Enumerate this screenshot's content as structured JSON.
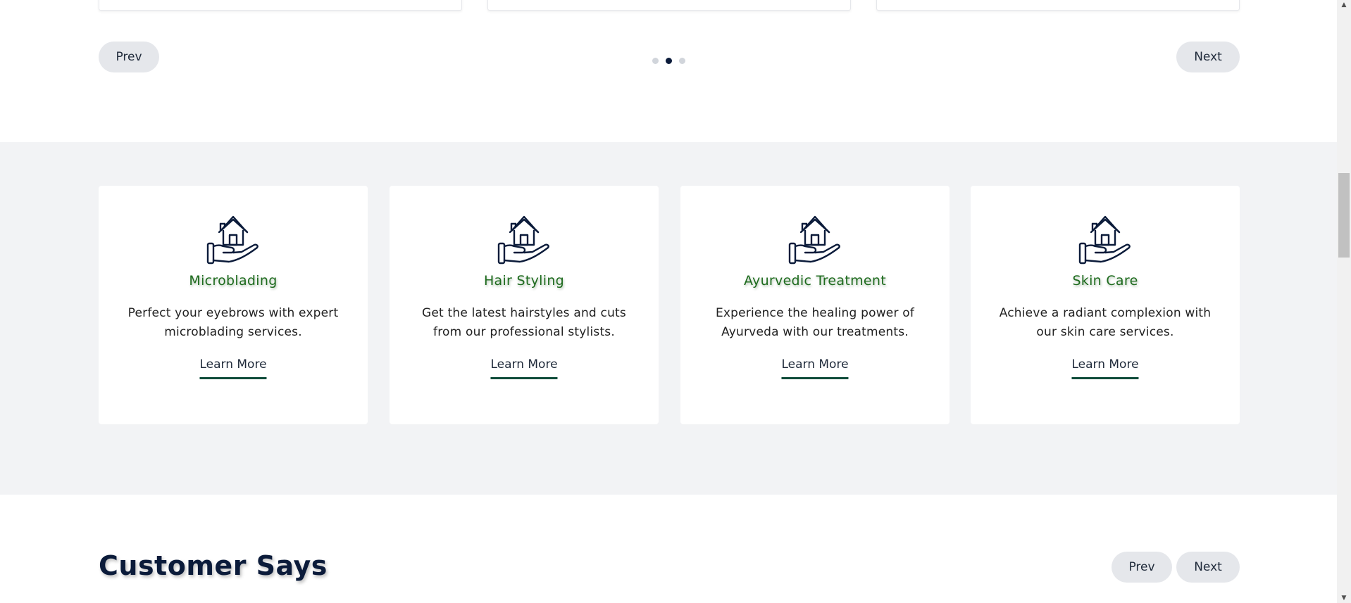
{
  "top_carousel": {
    "prev_label": "Prev",
    "next_label": "Next",
    "pages": 3,
    "active_page": 2
  },
  "services": [
    {
      "icon": "house-in-hand-icon",
      "title": "Microblading",
      "description": "Perfect your eyebrows with expert microblading services.",
      "link": "Learn More"
    },
    {
      "icon": "house-in-hand-icon",
      "title": "Hair Styling",
      "description": "Get the latest hairstyles and cuts from our professional stylists.",
      "link": "Learn More"
    },
    {
      "icon": "house-in-hand-icon",
      "title": "Ayurvedic Treatment",
      "description": "Experience the healing power of Ayurveda with our treatments.",
      "link": "Learn More"
    },
    {
      "icon": "house-in-hand-icon",
      "title": "Skin Care",
      "description": "Achieve a radiant complexion with our skin care services.",
      "link": "Learn More"
    }
  ],
  "testimonials": {
    "title": "Customer Says",
    "prev_label": "Prev",
    "next_label": "Next"
  },
  "colors": {
    "title_green": "#1e6b1e",
    "navy": "#0b1b3a",
    "underline": "#0f4c3a",
    "band_bg": "#f2f3f5",
    "button_bg": "#e5e7eb"
  }
}
